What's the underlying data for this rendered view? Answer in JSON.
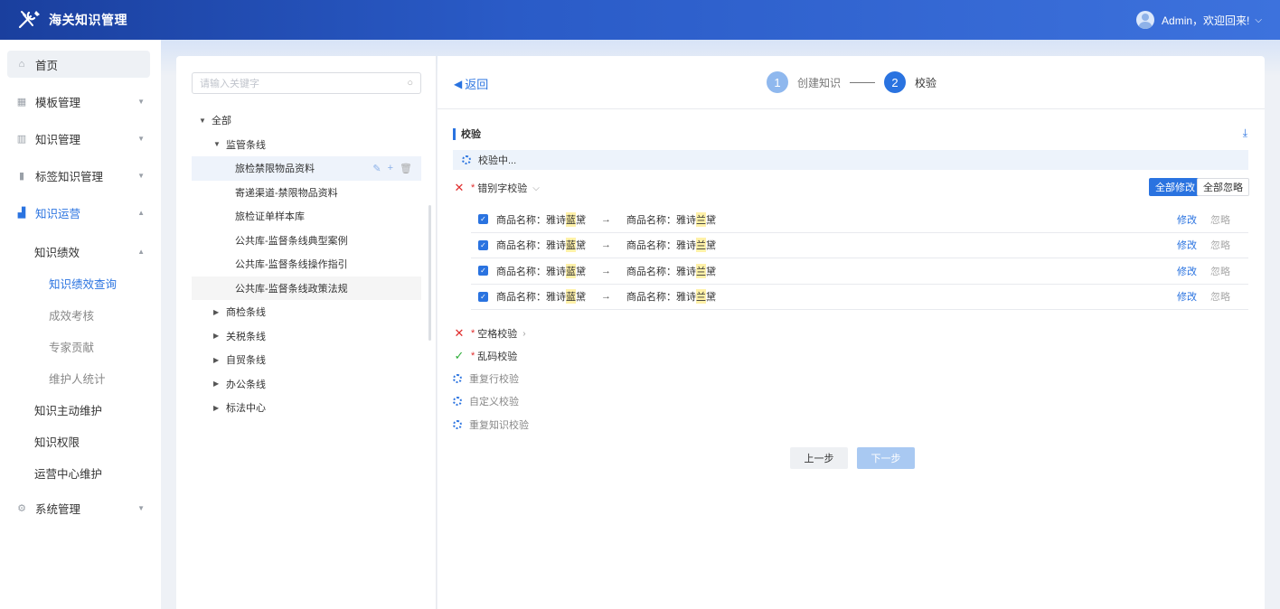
{
  "header": {
    "app_title": "海关知识管理",
    "user_greeting": "Admin，欢迎回来!",
    "colors": {
      "header_start": "#1a3f9e",
      "header_end": "#3d72dd",
      "accent": "#2a73e0"
    }
  },
  "sidebar": {
    "items": [
      {
        "label": "首页",
        "icon": "home-icon"
      },
      {
        "label": "模板管理",
        "icon": "template-icon"
      },
      {
        "label": "知识管理",
        "icon": "books-icon"
      },
      {
        "label": "标签知识管理",
        "icon": "tag-icon"
      },
      {
        "label": "知识运营",
        "icon": "chart-icon"
      },
      {
        "label": "系统管理",
        "icon": "gear-icon"
      }
    ],
    "sub": {
      "performance": "知识绩效",
      "perf_query": "知识绩效查询",
      "assessment": "成效考核",
      "expert": "专家贡献",
      "maintainer": "维护人统计",
      "active_maint": "知识主动维护",
      "permission": "知识权限",
      "ops_center": "运营中心维护"
    }
  },
  "tree": {
    "search_placeholder": "请输入关键字",
    "nodes": {
      "all": "全部",
      "supervision": "监管条线",
      "item1": "旅检禁限物品资料",
      "item2": "寄递渠道-禁限物品资料",
      "item3": "旅检证单样本库",
      "item4": "公共库-监督条线典型案例",
      "item5": "公共库-监督条线操作指引",
      "item6": "公共库-监督条线政策法规",
      "commodity": "商检条线",
      "tariff": "关税条线",
      "ftz": "自贸条线",
      "office": "办公条线",
      "standard": "标法中心"
    }
  },
  "main": {
    "back": "返回",
    "steps": [
      {
        "num": "1",
        "label": "创建知识"
      },
      {
        "num": "2",
        "label": "校验"
      }
    ],
    "section_title": "校验",
    "status": "校验中...",
    "typo_check": "错别字校验",
    "btn_fix_all": "全部修改",
    "btn_ignore_all": "全部忽略",
    "rows": [
      {
        "prefix": "商品名称：雅诗",
        "wrong": "蓝",
        "suffix": "黛",
        "fixed_prefix": "商品名称：雅诗",
        "right": "兰",
        "fixed_suffix": "黛",
        "fix": "修改",
        "ignore": "忽略"
      },
      {
        "prefix": "商品名称：雅诗",
        "wrong": "蓝",
        "suffix": "黛",
        "fixed_prefix": "商品名称：雅诗",
        "right": "兰",
        "fixed_suffix": "黛",
        "fix": "修改",
        "ignore": "忽略"
      },
      {
        "prefix": "商品名称：雅诗",
        "wrong": "蓝",
        "suffix": "黛",
        "fixed_prefix": "商品名称：雅诗",
        "right": "兰",
        "fixed_suffix": "黛",
        "fix": "修改",
        "ignore": "忽略"
      },
      {
        "prefix": "商品名称：雅诗",
        "wrong": "蓝",
        "suffix": "黛",
        "fixed_prefix": "商品名称：雅诗",
        "right": "兰",
        "fixed_suffix": "黛",
        "fix": "修改",
        "ignore": "忽略"
      }
    ],
    "space_check": "空格校验",
    "garble_check": "乱码校验",
    "dup_line_check": "重复行校验",
    "custom_check": "自定义校验",
    "dup_knowledge_check": "重复知识校验",
    "btn_prev": "上一步",
    "btn_next": "下一步"
  }
}
